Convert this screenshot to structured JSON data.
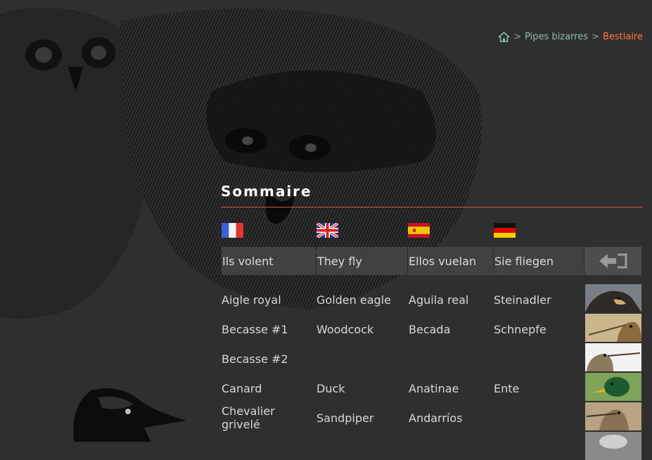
{
  "breadcrumb": {
    "home_icon": "home-icon",
    "separator": ">",
    "link": "Pipes bizarres",
    "current": "Bestiaire"
  },
  "page_title": "Sommaire",
  "languages": [
    {
      "flag": "france-flag-icon",
      "header": "Ils volent"
    },
    {
      "flag": "uk-flag-icon",
      "header": "They fly"
    },
    {
      "flag": "spain-flag-icon",
      "header": "Ellos vuelan"
    },
    {
      "flag": "germany-flag-icon",
      "header": "Sie fliegen"
    }
  ],
  "back_icon": "exit-arrow-icon",
  "rows": [
    {
      "fr": "Aigle royal",
      "en": "Golden eagle",
      "es": "Aguila real",
      "de": "Steinadler",
      "thumb": "eagle-thumbnail"
    },
    {
      "fr": "Becasse #1",
      "en": "Woodcock",
      "es": "Becada",
      "de": "Schnepfe",
      "thumb": "woodcock-thumbnail"
    },
    {
      "fr": "Becasse #2",
      "en": "",
      "es": "",
      "de": "",
      "thumb": "snipe-thumbnail"
    },
    {
      "fr": "Canard",
      "en": "Duck",
      "es": "Anatinae",
      "de": "Ente",
      "thumb": "duck-thumbnail"
    },
    {
      "fr": "Chevalier",
      "fr2": "grivelé",
      "en": "Sandpiper",
      "es": "Andarríos",
      "de": "",
      "thumb": "sandpiper-thumbnail"
    }
  ],
  "colors": {
    "background": "#2f2f2f",
    "accent": "#ff7a3a",
    "link": "#8fbfa6",
    "rule": "#d3583b"
  }
}
